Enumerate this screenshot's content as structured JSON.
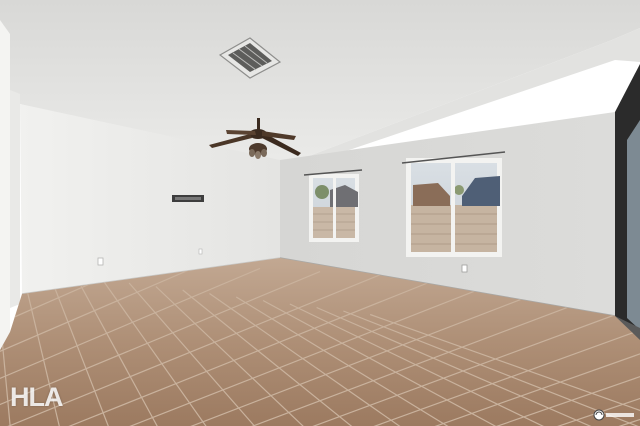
{
  "watermark": {
    "text": "HLA"
  },
  "icons": {
    "corner_logo": "corner-logo-icon",
    "ceiling_fan": "ceiling-fan-icon"
  },
  "colors": {
    "wall": "#dcdcda",
    "ceiling": "#e6e6e4",
    "floor": "#a8876c",
    "grout": "#bca58f",
    "window_sky": "#cfd6dc"
  }
}
